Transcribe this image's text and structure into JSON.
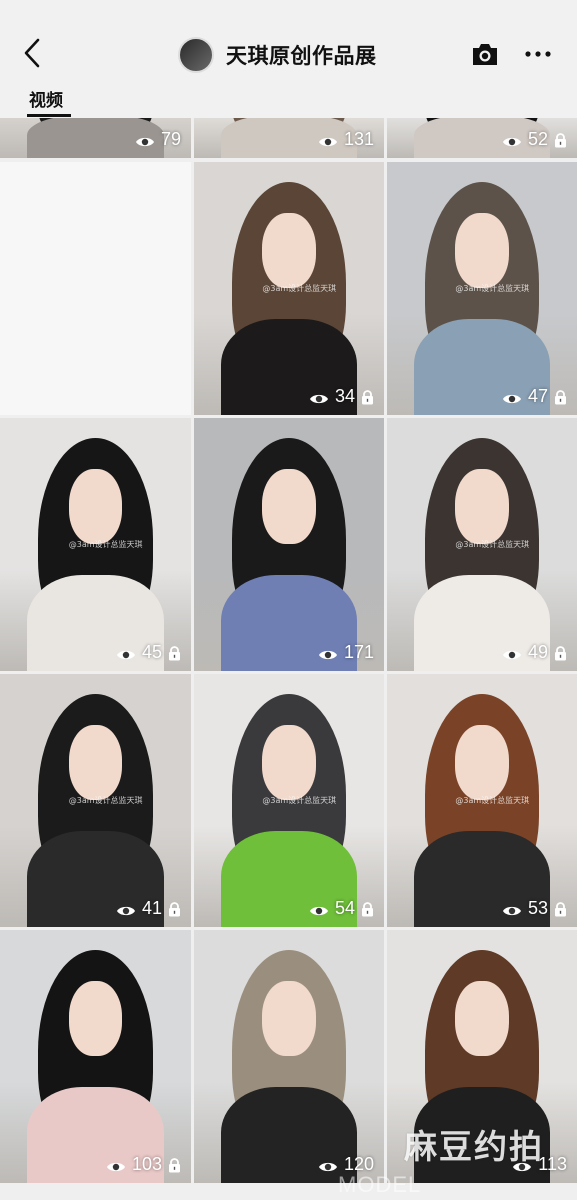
{
  "header": {
    "title": "天琪原创作品展",
    "tab_label": "视频"
  },
  "grid": {
    "rows": [
      [
        {
          "views": "79",
          "locked": false,
          "palette": [
            "#d8d4d0",
            "#1a1a1a",
            "#9a9590"
          ]
        },
        {
          "views": "131",
          "locked": false,
          "palette": [
            "#e3e0dc",
            "#6b5a4c",
            "#cfc8c0"
          ]
        },
        {
          "views": "52",
          "locked": true,
          "palette": [
            "#e6e4e2",
            "#111111",
            "#d0c8c2"
          ]
        }
      ],
      [
        {
          "views": "",
          "locked": false,
          "empty": true
        },
        {
          "views": "34",
          "locked": true,
          "watermark": "@3am设计总监天琪",
          "palette": [
            "#d9d6d3",
            "#5a4536",
            "#1c1a1a"
          ]
        },
        {
          "views": "47",
          "locked": true,
          "watermark": "@3am设计总监天琪",
          "palette": [
            "#c7c9cc",
            "#5c5249",
            "#8aa0b4"
          ]
        }
      ],
      [
        {
          "views": "45",
          "locked": true,
          "watermark": "@3am设计总监天琪",
          "palette": [
            "#e4e3e2",
            "#161616",
            "#e9e6e2"
          ]
        },
        {
          "views": "171",
          "locked": false,
          "palette": [
            "#b8b9bb",
            "#1a1a1a",
            "#6f7fb4"
          ]
        },
        {
          "views": "49",
          "locked": true,
          "watermark": "@3am设计总监天琪",
          "palette": [
            "#dcdcdc",
            "#3b3431",
            "#eeeae6"
          ]
        }
      ],
      [
        {
          "views": "41",
          "locked": true,
          "watermark": "@3am设计总监天琪",
          "palette": [
            "#d6d2cf",
            "#1b1b1b",
            "#2a2a2a"
          ]
        },
        {
          "views": "54",
          "locked": true,
          "watermark": "@3am设计总监天琪",
          "palette": [
            "#e8e6e4",
            "#3a3a3c",
            "#6fbf3a"
          ]
        },
        {
          "views": "53",
          "locked": true,
          "watermark": "@3am设计总监天琪",
          "palette": [
            "#e2dfdc",
            "#7a4328",
            "#2a2a2a"
          ]
        }
      ],
      [
        {
          "views": "103",
          "locked": true,
          "palette": [
            "#d7d9db",
            "#141414",
            "#e9c9c8"
          ]
        },
        {
          "views": "120",
          "locked": false,
          "palette": [
            "#dcdcdc",
            "#9a8f7e",
            "#232323"
          ]
        },
        {
          "views": "113",
          "locked": false,
          "palette": [
            "#e4e2e0",
            "#5e3a27",
            "#1f1f1f"
          ]
        }
      ]
    ]
  },
  "watermark_brand": {
    "title": "麻豆约拍",
    "subtitle": "MODEL PHOTOGRAPHY"
  }
}
